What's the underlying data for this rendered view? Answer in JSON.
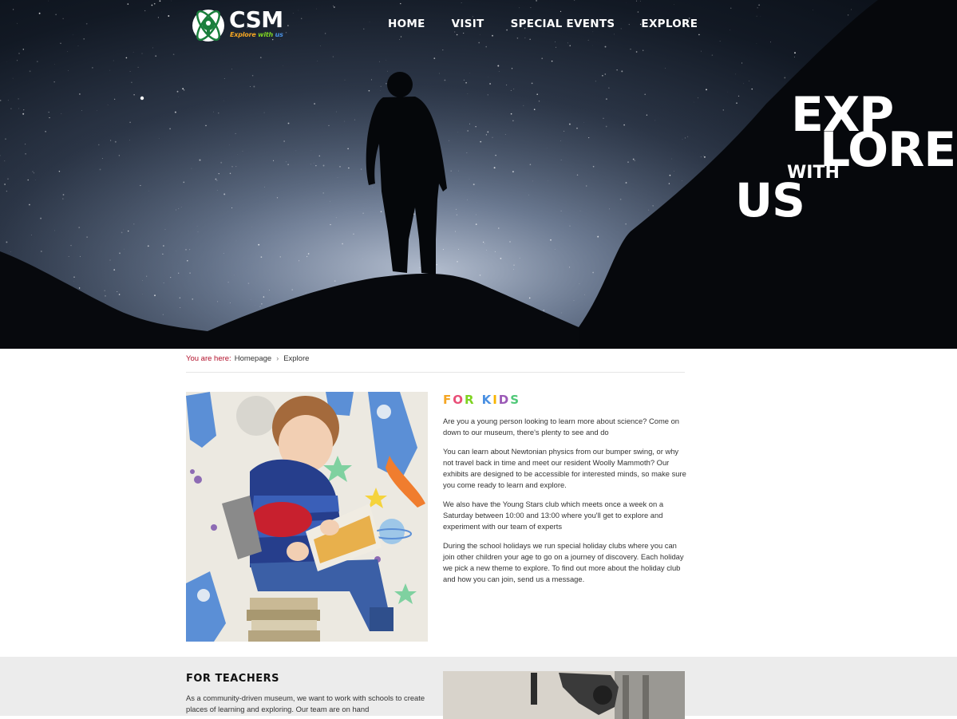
{
  "header": {
    "logo_text": "CSM",
    "logo_tagline_parts": [
      "Explore",
      "with",
      "us"
    ],
    "nav": [
      {
        "label": "HOME"
      },
      {
        "label": "VISIT"
      },
      {
        "label": "SPECIAL EVENTS"
      },
      {
        "label": "EXPLORE"
      }
    ]
  },
  "hero": {
    "title_line1": "EXP",
    "title_line2": "LORE",
    "title_line3": "WITH",
    "title_line4": "US"
  },
  "breadcrumb": {
    "label": "You are here:",
    "home": "Homepage",
    "separator": "›",
    "current": "Explore"
  },
  "kids": {
    "title_letters": [
      "F",
      "O",
      "R",
      " ",
      "K",
      "I",
      "D",
      "S"
    ],
    "title_colors": [
      "#f5a623",
      "#e94e77",
      "#7ed321",
      "#ffffff",
      "#4a90e2",
      "#f8b400",
      "#9b59b6",
      "#50c878"
    ],
    "paragraphs": [
      "Are you a young person looking to learn more about science? Come on down to our museum, there's plenty to see and do",
      "You can learn about Newtonian physics from our bumper swing, or why not travel back in time and meet our resident Woolly Mammoth? Our exhibits are designed to be accessible for interested minds, so make sure you come ready to learn and explore.",
      "We also have the Young Stars club which meets once a week on a Saturday between 10:00 and 13:00 where you'll get to explore and experiment with our team of experts",
      "During the school holidays we run special holiday clubs where you can join other children your age to go on a journey of discovery. Each holiday we pick a new theme to explore. To find out more about the holiday club and how you can join, send us a message."
    ]
  },
  "teachers": {
    "title": "FOR TEACHERS",
    "text": "As a community-driven museum, we want to work with schools to create places of learning and exploring. Our team are on hand"
  },
  "colors": {
    "breadcrumb_label": "#b2102a",
    "teachers_bg": "#ececec"
  }
}
